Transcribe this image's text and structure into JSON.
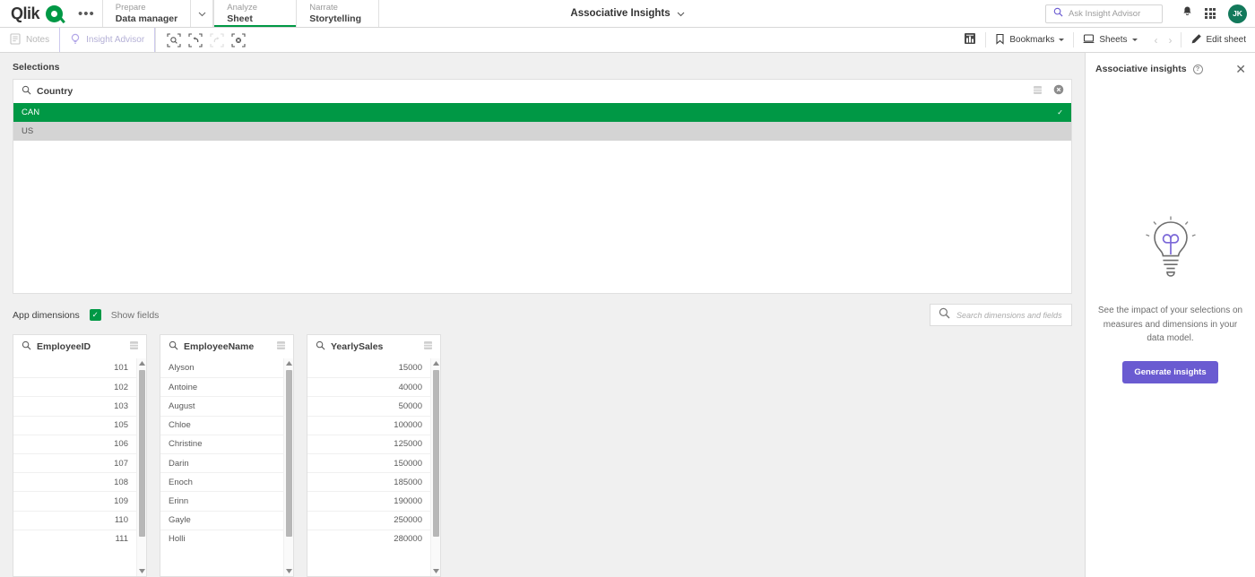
{
  "topbar": {
    "brand": "Qlik",
    "brand_icon": "qlik-logo-icon",
    "more_label": "•••",
    "nav": [
      {
        "top": "Prepare",
        "bottom": "Data manager",
        "active": false
      },
      {
        "top": "Analyze",
        "bottom": "Sheet",
        "active": true
      },
      {
        "top": "Narrate",
        "bottom": "Storytelling",
        "active": false
      }
    ],
    "center_title": "Associative Insights",
    "search_placeholder": "Ask Insight Advisor",
    "avatar_initials": "JK"
  },
  "toolbar": {
    "notes_label": "Notes",
    "insight_advisor_label": "Insight Advisor",
    "bookmarks_label": "Bookmarks",
    "sheets_label": "Sheets",
    "edit_sheet_label": "Edit sheet",
    "tools": [
      "selection-search-icon",
      "step-back-icon",
      "step-forward-icon",
      "clear-all-icon"
    ]
  },
  "selections": {
    "heading": "Selections",
    "field": {
      "title": "Country",
      "values": [
        {
          "label": "CAN",
          "state": "selected"
        },
        {
          "label": "US",
          "state": "alternative"
        }
      ]
    }
  },
  "appdim": {
    "label": "App dimensions",
    "show_fields_label": "Show fields",
    "show_fields_checked": true,
    "search_placeholder": "Search dimensions and fields"
  },
  "fields": [
    {
      "title": "EmployeeID",
      "align": "right",
      "values": [
        "101",
        "102",
        "103",
        "105",
        "106",
        "107",
        "108",
        "109",
        "110",
        "111"
      ]
    },
    {
      "title": "EmployeeName",
      "align": "left",
      "values": [
        "Alyson",
        "Antoine",
        "August",
        "Chloe",
        "Christine",
        "Darin",
        "Enoch",
        "Erinn",
        "Gayle",
        "Holli"
      ]
    },
    {
      "title": "YearlySales",
      "align": "right",
      "values": [
        "15000",
        "40000",
        "50000",
        "100000",
        "125000",
        "150000",
        "185000",
        "190000",
        "250000",
        "280000"
      ]
    }
  ],
  "insights_panel": {
    "title": "Associative insights",
    "help_icon": "question-mark-icon",
    "close_icon": "close-icon",
    "illustration": "lightbulb-icon",
    "description": "See the impact of your selections on measures and dimensions in your data model.",
    "generate_label": "Generate insights"
  },
  "colors": {
    "qlik_green": "#009845",
    "selected_green": "#009845",
    "alternative_grey": "#d4d4d4",
    "accent_purple": "#6a5bd1",
    "avatar_green": "#13795b",
    "page_bg": "#f0f0f0"
  }
}
